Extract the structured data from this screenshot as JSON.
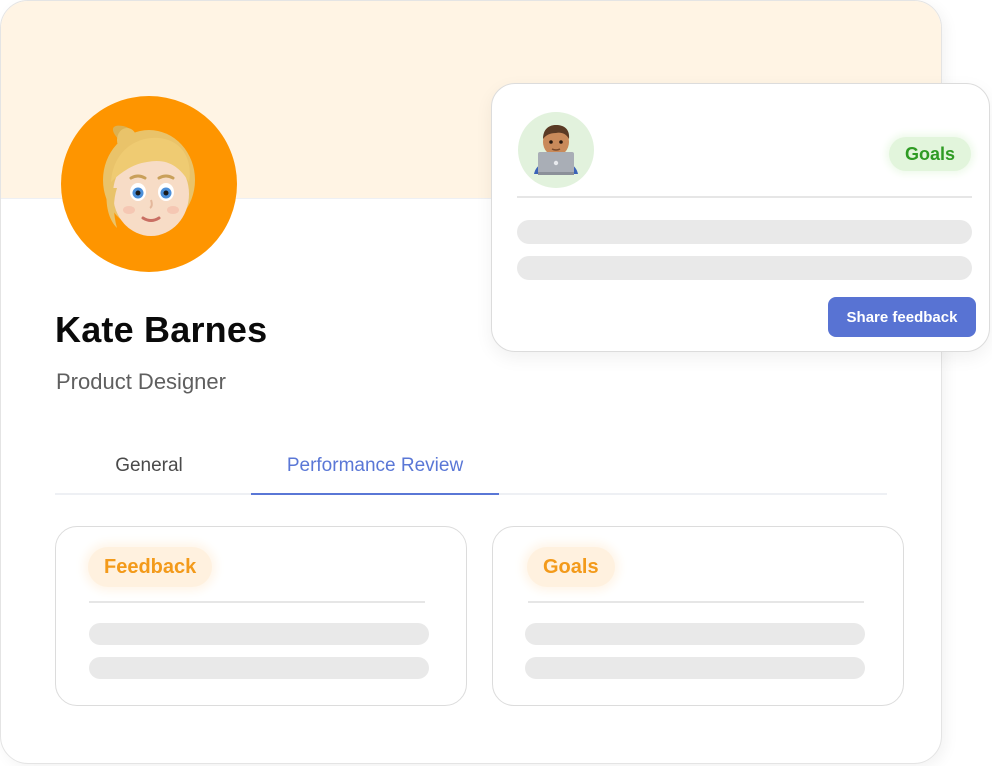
{
  "profile": {
    "name": "Kate Barnes",
    "role": "Product Designer",
    "avatar_icon": "blonde-woman-emoji-avatar"
  },
  "tabs": [
    {
      "label": "General",
      "active": false
    },
    {
      "label": "Performance Review",
      "active": true
    }
  ],
  "cards": {
    "feedback": {
      "label": "Feedback"
    },
    "goals": {
      "label": "Goals"
    }
  },
  "feedback_popup": {
    "avatar_icon": "man-with-laptop-emoji-avatar",
    "badge": "Goals",
    "share_label": "Share feedback"
  },
  "colors": {
    "banner": "#fff4e4",
    "avatar_bg": "#fe9500",
    "accent_blue": "#5a77d6",
    "button_blue": "#5873d3",
    "orange_text": "#f39a1a",
    "green_text": "#2f9b24"
  }
}
